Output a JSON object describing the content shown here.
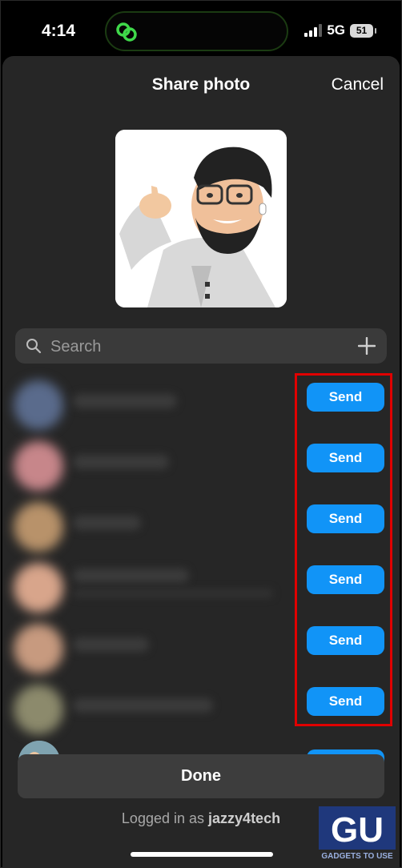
{
  "status": {
    "time": "4:14",
    "network": "5G",
    "battery": "51"
  },
  "sheet": {
    "title": "Share photo",
    "cancel_label": "Cancel"
  },
  "search": {
    "placeholder": "Search"
  },
  "contacts": [
    {
      "send_label": "Send",
      "avatar_color": "#5a6b8c"
    },
    {
      "send_label": "Send",
      "avatar_color": "#c7868a"
    },
    {
      "send_label": "Send",
      "avatar_color": "#b8926a"
    },
    {
      "send_label": "Send",
      "avatar_color": "#d8a58b"
    },
    {
      "send_label": "Send",
      "avatar_color": "#c79a7f"
    },
    {
      "send_label": "Send",
      "avatar_color": "#8c8a6c"
    }
  ],
  "footer": {
    "done_label": "Done",
    "logged_prefix": "Logged in as",
    "username": "jazzy4tech"
  },
  "watermark": {
    "text": "GADGETS TO USE"
  },
  "colors": {
    "accent": "#1194f7",
    "sheet": "#262626",
    "highlight": "#e00000"
  }
}
